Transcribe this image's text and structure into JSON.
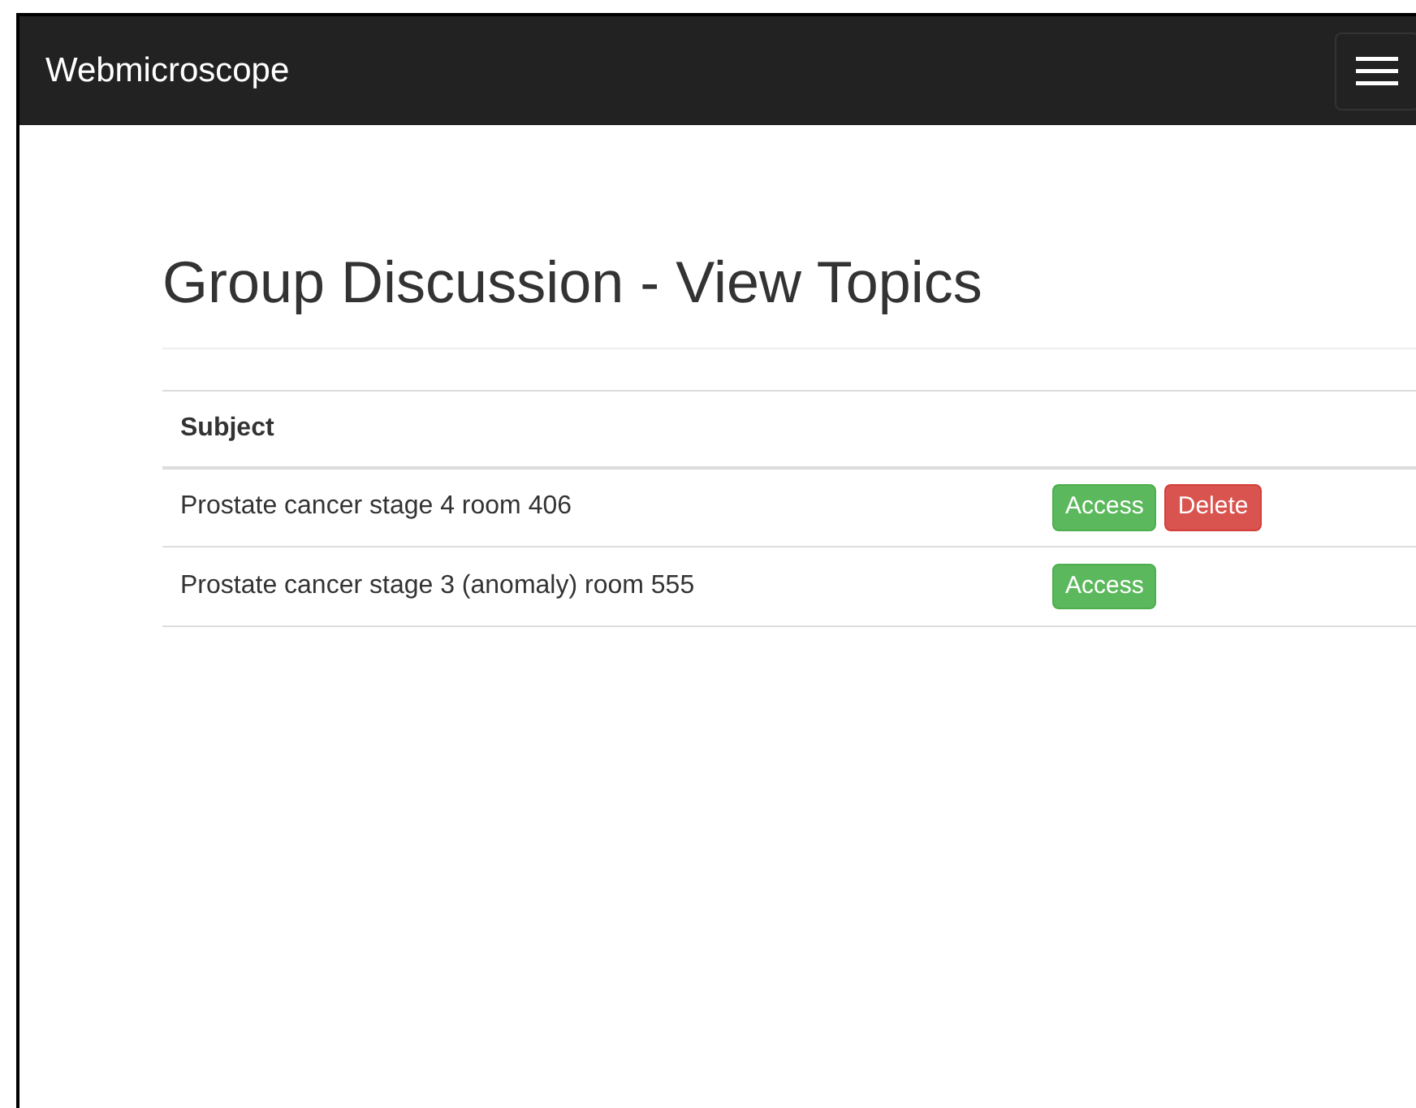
{
  "navbar": {
    "brand": "Webmicroscope"
  },
  "title": "Group Discussion - View Topics",
  "table": {
    "columns": [
      "Subject"
    ],
    "rows": [
      {
        "subject": "Prostate cancer stage 4 room 406",
        "actions": [
          {
            "label": "Access",
            "kind": "access"
          },
          {
            "label": "Delete",
            "kind": "delete"
          }
        ]
      },
      {
        "subject": "Prostate cancer stage 3 (anomaly) room 555",
        "actions": [
          {
            "label": "Access",
            "kind": "access"
          }
        ]
      }
    ]
  }
}
